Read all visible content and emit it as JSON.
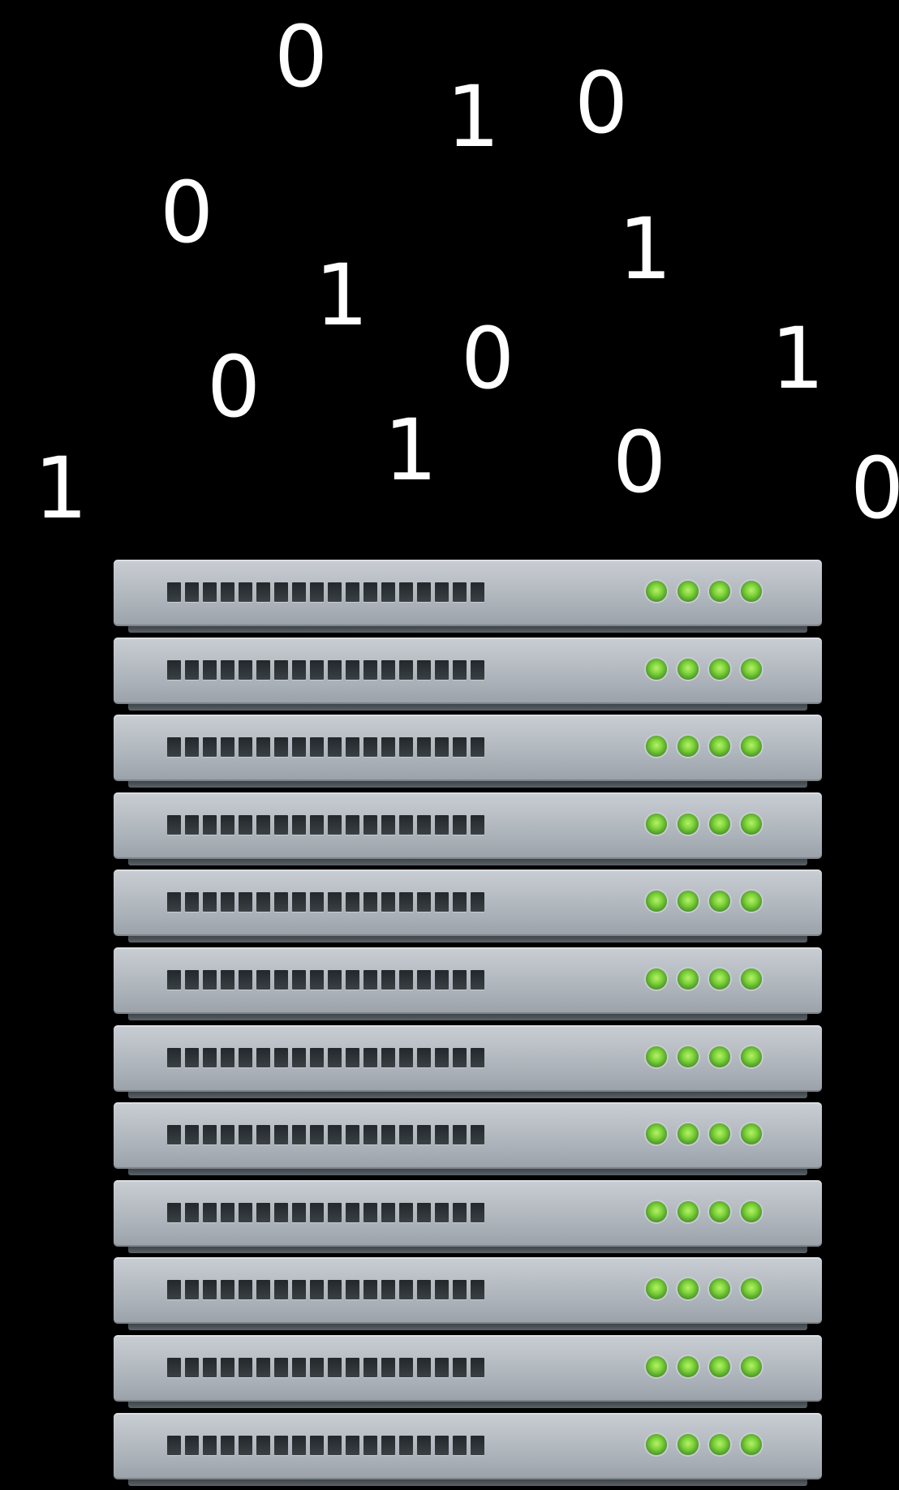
{
  "digits": [
    "0",
    "1",
    "0",
    "0",
    "1",
    "1",
    "0",
    "1",
    "0",
    "1",
    "0",
    "1",
    "0"
  ],
  "colors": {
    "background": "#000000",
    "digit": "#ffffff",
    "chassis": "#b9bfc5",
    "led": "#7fd43a"
  },
  "rack": {
    "unit_count": 12,
    "leds_per_unit": 4,
    "icon": "server-rack-icon"
  }
}
